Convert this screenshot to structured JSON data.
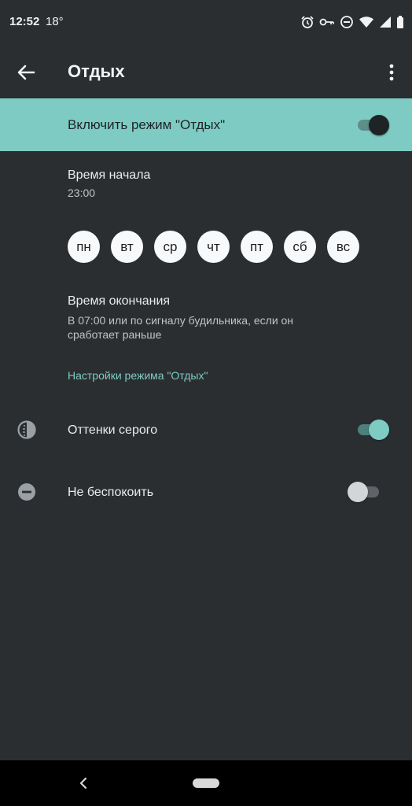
{
  "status_bar": {
    "time": "12:52",
    "temperature": "18°",
    "icons": [
      "alarm-icon",
      "vpn-key-icon",
      "dnd-icon",
      "wifi-icon",
      "signal-icon",
      "battery-icon"
    ]
  },
  "app_bar": {
    "title": "Отдых",
    "back_icon": "arrow-back-icon",
    "more_icon": "more-vert-icon"
  },
  "master_switch": {
    "label": "Включить режим \"Отдых\"",
    "on": true
  },
  "start_time": {
    "title": "Время начала",
    "value": "23:00"
  },
  "days": [
    "пн",
    "вт",
    "ср",
    "чт",
    "пт",
    "сб",
    "вс"
  ],
  "end_time": {
    "title": "Время окончания",
    "value": "В 07:00 или по сигналу будильника, если он сработает раньше"
  },
  "settings_link": "Настройки режима \"Отдых\"",
  "options": [
    {
      "label": "Оттенки серого",
      "icon": "grayscale-icon",
      "on": true
    },
    {
      "label": "Не беспокоить",
      "icon": "do-not-disturb-icon",
      "on": false
    }
  ],
  "colors": {
    "background": "#2b2e31",
    "accent": "#7ecbc4",
    "text_primary": "#e9ecee",
    "text_secondary": "#bfc4c7"
  },
  "nav_bar": {
    "back_icon": "nav-back-icon",
    "home_icon": "nav-home-pill"
  }
}
